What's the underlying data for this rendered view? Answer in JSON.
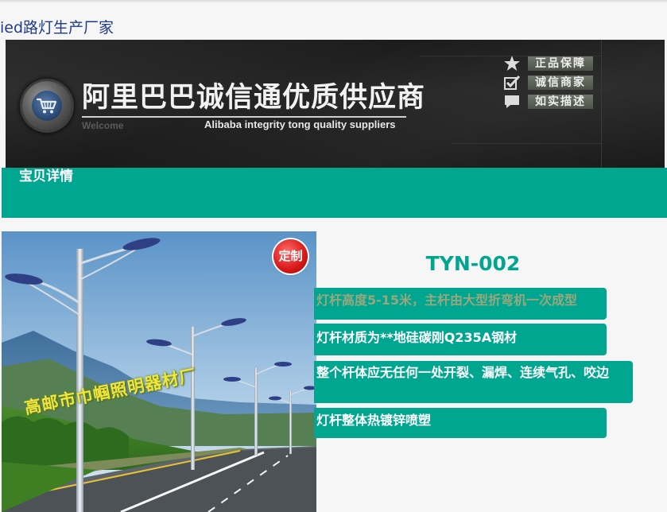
{
  "page": {
    "title": "ied路灯生产厂家"
  },
  "banner": {
    "title": "阿里巴巴诚信通优质供应商",
    "welcome": "Welcome",
    "subtitle": "Alibaba integrity tong quality suppliers",
    "badges": [
      {
        "icon": "star-icon",
        "label": "正品保障"
      },
      {
        "icon": "checkmark-icon",
        "label": "诚信商家"
      },
      {
        "icon": "speech-bubble-icon",
        "label": "如实描述"
      }
    ]
  },
  "section": {
    "title": "宝贝详情"
  },
  "product": {
    "image_caption": "高邮市巾帼照明器材厂",
    "custom_badge": "定制",
    "model": "TYN-002",
    "features": [
      "灯杆高度5-15米，主杆由大型折弯机一次成型",
      "灯杆材质为**地硅碳刚Q235A钢材",
      "整个杆体应无任何一处开裂、漏焊、连续气孔、咬边",
      "灯杆整体热镀锌喷塑"
    ]
  },
  "colors": {
    "accent": "#00a690",
    "title_link": "#1f3a8c",
    "banner_bg": "#1f1f1f",
    "caption_yellow": "#f1e43a",
    "badge_red": "#d81818"
  }
}
